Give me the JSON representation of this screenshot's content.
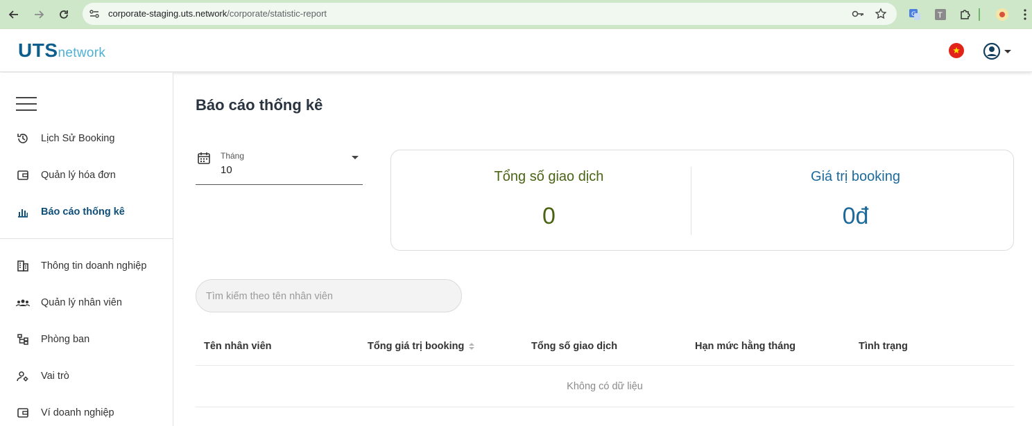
{
  "browser": {
    "url_host": "corporate-staging.uts.network",
    "url_path": "/corporate/statistic-report"
  },
  "header": {
    "logo_main": "UTS",
    "logo_sub": "network"
  },
  "sidebar": {
    "items": [
      {
        "label": "Lịch Sử Booking",
        "icon": "history-icon"
      },
      {
        "label": "Quản lý hóa đơn",
        "icon": "wallet-icon"
      },
      {
        "label": "Báo cáo thống kê",
        "icon": "bar-chart-icon",
        "active": true
      },
      {
        "label": "Thông tin doanh nghiệp",
        "icon": "building-icon"
      },
      {
        "label": "Quản lý nhân viên",
        "icon": "group-icon"
      },
      {
        "label": "Phòng ban",
        "icon": "tree-icon"
      },
      {
        "label": "Vai trò",
        "icon": "user-gear-icon"
      },
      {
        "label": "Ví doanh nghiệp",
        "icon": "wallet-icon"
      }
    ]
  },
  "main": {
    "title": "Báo cáo thống kê",
    "month_filter": {
      "label": "Tháng",
      "value": "10"
    },
    "stats": {
      "transactions_label": "Tổng số giao dịch",
      "transactions_value": "0",
      "booking_label": "Giá trị booking",
      "booking_value": "0đ"
    },
    "search": {
      "placeholder": "Tìm kiếm theo tên nhân viên"
    },
    "table": {
      "columns": [
        "Tên nhân viên",
        "Tổng giá trị booking",
        "Tổng số giao dịch",
        "Hạn mức hằng tháng",
        "Tình trạng"
      ],
      "empty_text": "Không có dữ liệu"
    }
  },
  "colors": {
    "brand": "#0e5f8e",
    "brand_light": "#4fb0d6",
    "stat_green": "#4a6414",
    "stat_blue": "#1d6a9a",
    "browser_bar": "#cfe7c9"
  }
}
